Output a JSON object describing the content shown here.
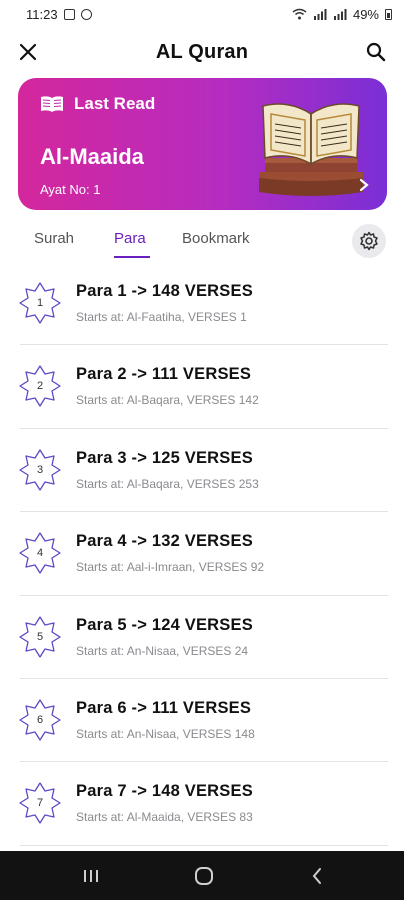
{
  "status_bar": {
    "time": "11:23",
    "battery": "49%"
  },
  "app_bar": {
    "title": "AL Quran"
  },
  "last_read": {
    "label": "Last Read",
    "surah": "Al-Maaida",
    "ayat": "Ayat No: 1"
  },
  "tabs": [
    {
      "label": "Surah"
    },
    {
      "label": "Para"
    },
    {
      "label": "Bookmark"
    }
  ],
  "active_tab": "Para",
  "paras": [
    {
      "number": "1",
      "title": "Para 1 -> 148 VERSES",
      "subtitle": "Starts at: Al-Faatiha, VERSES 1"
    },
    {
      "number": "2",
      "title": "Para 2 -> 111 VERSES",
      "subtitle": "Starts at: Al-Baqara, VERSES 142"
    },
    {
      "number": "3",
      "title": "Para 3 -> 125 VERSES",
      "subtitle": "Starts at: Al-Baqara, VERSES 253"
    },
    {
      "number": "4",
      "title": "Para 4 -> 132 VERSES",
      "subtitle": "Starts at: Aal-i-Imraan, VERSES 92"
    },
    {
      "number": "5",
      "title": "Para 5 -> 124 VERSES",
      "subtitle": "Starts at: An-Nisaa, VERSES 24"
    },
    {
      "number": "6",
      "title": "Para 6 -> 111 VERSES",
      "subtitle": "Starts at: An-Nisaa, VERSES 148"
    },
    {
      "number": "7",
      "title": "Para 7 -> 148 VERSES",
      "subtitle": "Starts at: Al-Maaida, VERSES 83"
    }
  ],
  "colors": {
    "accent": "#6a1fbf",
    "card_start": "#d4279c",
    "card_end": "#7a2fd6",
    "badge_stroke": "#5b4bc4"
  }
}
